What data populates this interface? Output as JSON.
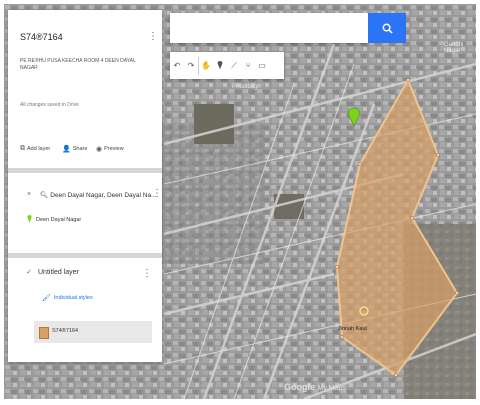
{
  "panel": {
    "map_title": "S74®7164",
    "map_description": "PE RE®HU PUSA KEECHA ROOM 4 DEEN DAYAL NAGAR",
    "save_status": "All changes saved in Drive",
    "actions": {
      "add_layer": "Add layer",
      "share": "Share",
      "preview": "Preview"
    },
    "search_layer": {
      "label": "Deen Dayal Nagar, Deen Dayal Na...",
      "place": "Deen Dayal Nagar"
    },
    "layer": {
      "name": "Untitled layer",
      "style_link": "Individual styles",
      "feature": "S74®7164"
    }
  },
  "map": {
    "labels": {
      "place_top": "Phoolbagh",
      "place_right": "Gandhi Nagar",
      "marker_label": "Jinnah Kaul"
    },
    "attribution": {
      "brand": "Google",
      "suffix": "My Maps"
    },
    "polygon_color": "#d9a066"
  },
  "search": {
    "placeholder": ""
  },
  "toolbar": {
    "tools": [
      "undo-icon",
      "redo-icon",
      "hand-icon",
      "marker-icon",
      "line-icon",
      "route-icon",
      "ruler-icon"
    ]
  }
}
